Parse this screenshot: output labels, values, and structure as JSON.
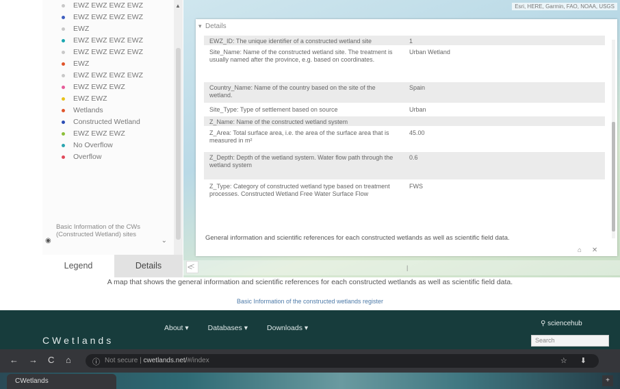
{
  "sidebar": {
    "legend_items": [
      {
        "label": "EWZ EWZ EWZ EWZ",
        "color": "#c8c8c8"
      },
      {
        "label": "EWZ EWZ EWZ EWZ",
        "color": "#3f5fbf"
      },
      {
        "label": "EWZ",
        "color": "#c8c8c8"
      },
      {
        "label": "EWZ EWZ EWZ EWZ",
        "color": "#19a6b0"
      },
      {
        "label": "EWZ EWZ EWZ EWZ",
        "color": "#c8c8c8"
      },
      {
        "label": "EWZ",
        "color": "#e0552b"
      },
      {
        "label": "EWZ EWZ EWZ EWZ",
        "color": "#c8c8c8"
      },
      {
        "label": "EWZ EWZ EWZ",
        "color": "#e65c9a"
      },
      {
        "label": "EWZ EWZ",
        "color": "#e8c21b"
      },
      {
        "label": "Wetlands",
        "color": "#e0552b"
      },
      {
        "label": "Constructed Wetland",
        "color": "#2b4db5"
      },
      {
        "label": "EWZ EWZ EWZ",
        "color": "#8cbf3a"
      },
      {
        "label": "No Overflow",
        "color": "#2ba5b0"
      },
      {
        "label": "Overflow",
        "color": "#e04a5a"
      }
    ],
    "legend_note": "Basic Information of the CWs (Constructed Wetland) sites",
    "tab_legend": "Legend",
    "tab_details": "Details"
  },
  "map": {
    "attribution": "Esri, HERE, Garmin, FAO, NOAA, USGS",
    "zoom_label": "<",
    "bottom_left": "<",
    "bottom_mark": "|"
  },
  "details": {
    "header": "Details",
    "rows": [
      {
        "key": "EWZ_ID: The unique identifier of a constructed wetland site",
        "value": "1"
      },
      {
        "key": "Site_Name: Name of the constructed wetland site. The treatment is usually named after the province, e.g. based on coordinates.",
        "value": "Urban Wetland"
      },
      {
        "key": "Country_Name: Name of the country based on the site of the wetland.",
        "value": "Spain"
      },
      {
        "key": "Site_Type: Type of settlement based on source",
        "value": "Urban"
      },
      {
        "key": "Z_Name: Name of the constructed wetland system",
        "value": ""
      },
      {
        "key": "Z_Area: Total surface area, i.e. the area of the surface area that is measured in m²",
        "value": "45.00"
      },
      {
        "key": "Z_Depth: Depth of the wetland system. Water flow path through the wetland system",
        "value": "0.6"
      },
      {
        "key": "Z_Type: Category of constructed wetland type based on treatment processes. Constructed Wetland Free Water Surface Flow",
        "value": "FWS"
      }
    ],
    "footer": "General information and scientific references for each constructed wetlands as well as scientific field data."
  },
  "panel_buttons": "⌂ ✕",
  "captions": {
    "main": "A map that shows the general information and scientific references for each constructed wetlands as well as scientific field data.",
    "sub": "Basic Information of the constructed wetlands register"
  },
  "site": {
    "logo": "CWetlands",
    "nav": [
      "About ▾",
      "Databases ▾",
      "Downloads ▾"
    ],
    "brand": "⚲ sciencehub",
    "search_placeholder": "Search"
  },
  "browser": {
    "back": "←",
    "forward": "→",
    "reload": "C",
    "home": "⌂",
    "site_info": "ⓘ",
    "url_prefix": "Not secure | ",
    "url_main": "cwetlands.net/",
    "url_path": "#/index",
    "omnibox_icons": "☆ ⬇",
    "tab_title": "CWetlands",
    "tab_close": "+"
  }
}
